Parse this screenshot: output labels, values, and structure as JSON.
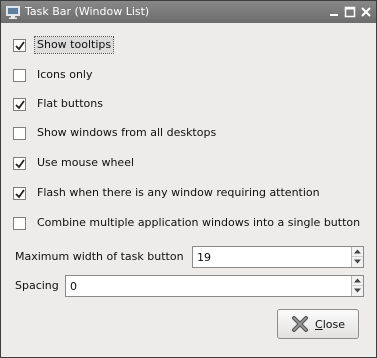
{
  "window": {
    "title": "Task Bar (Window List)",
    "title_icon": "monitor-icon",
    "controls": [
      "minimize-icon",
      "maximize-icon",
      "close-icon"
    ]
  },
  "options": [
    {
      "label": "Show tooltips",
      "checked": true
    },
    {
      "label": "Icons only",
      "checked": false
    },
    {
      "label": "Flat buttons",
      "checked": true
    },
    {
      "label": "Show windows from all desktops",
      "checked": false
    },
    {
      "label": "Use mouse wheel",
      "checked": true
    },
    {
      "label": "Flash when there is any window requiring attention",
      "checked": true
    },
    {
      "label": "Combine multiple application windows into a single button",
      "checked": false
    }
  ],
  "fields": {
    "max_width": {
      "label": "Maximum width of task button",
      "value": "19"
    },
    "spacing": {
      "label": "Spacing",
      "value": "0"
    }
  },
  "close_button": {
    "label_mnemonic": "C",
    "label_rest": "lose",
    "icon": "cross-icon"
  }
}
